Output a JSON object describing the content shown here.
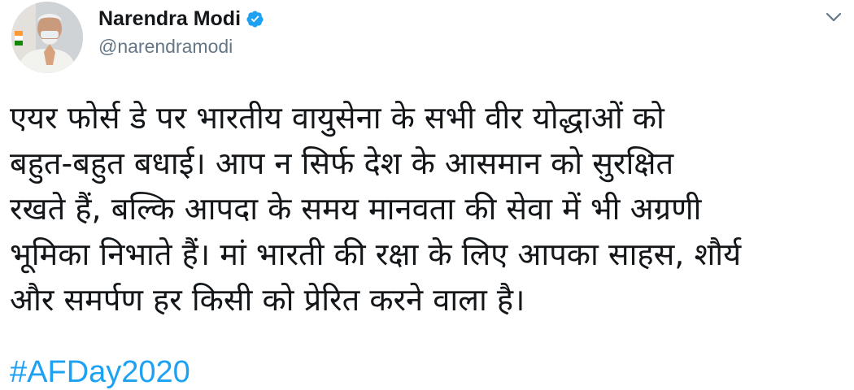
{
  "author": {
    "display_name": "Narendra Modi",
    "handle": "@narendramodi",
    "verified": true,
    "avatar_icon": "profile-photo-avatar"
  },
  "menu": {
    "icon": "chevron-down-icon"
  },
  "tweet": {
    "lines": [
      "एयर फोर्स डे पर भारतीय वायुसेना के सभी वीर योद्धाओं को",
      "बहुत-बहुत बधाई। आप न सिर्फ देश के आसमान को सुरक्षित",
      "रखते हैं, बल्कि आपदा के समय मानवता की सेवा में भी अग्रणी",
      "भूमिका निभाते हैं। मां भारती की रक्षा के लिए आपका साहस, शौर्य",
      "और समर्पण हर किसी को प्रेरित करने वाला है।"
    ],
    "hashtag": "#AFDay2020"
  },
  "colors": {
    "text": "#14171a",
    "muted": "#657786",
    "link": "#1da1f2",
    "verified_badge": "#1da1f2"
  }
}
